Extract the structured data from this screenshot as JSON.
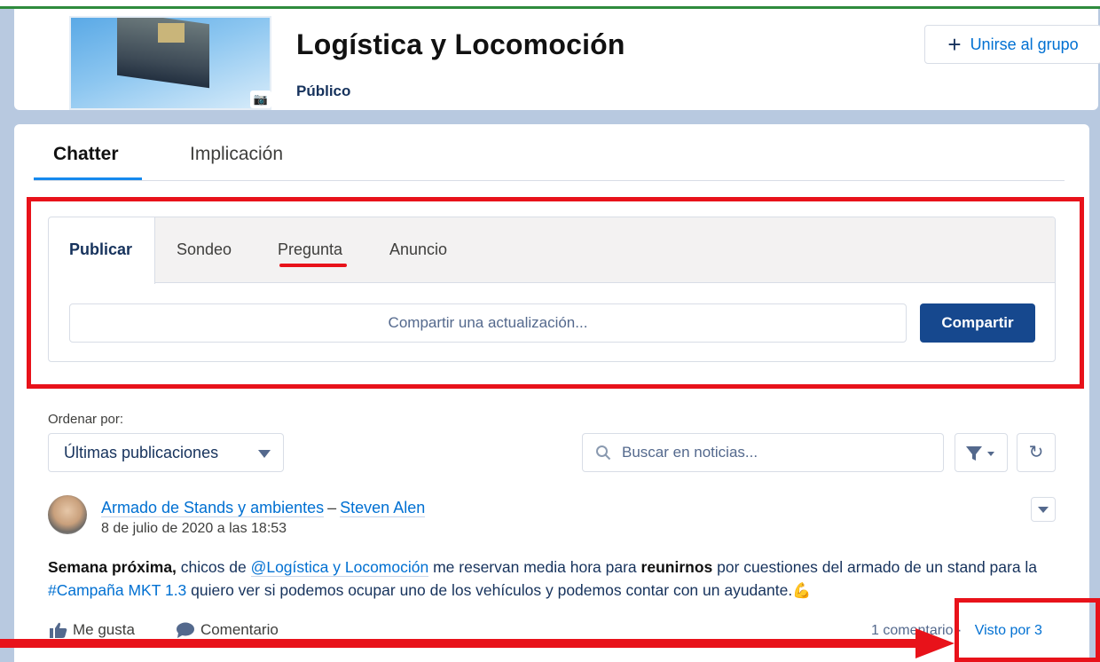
{
  "group": {
    "title": "Logística y Locomoción",
    "visibility": "Público",
    "join_label": "Unirse al grupo"
  },
  "tabs": [
    {
      "label": "Chatter",
      "active": true
    },
    {
      "label": "Implicación",
      "active": false
    }
  ],
  "publisher": {
    "tabs": [
      "Publicar",
      "Sondeo",
      "Pregunta",
      "Anuncio"
    ],
    "input_placeholder": "Compartir una actualización...",
    "share_label": "Compartir"
  },
  "feed": {
    "sort_label": "Ordenar por:",
    "sort_value": "Últimas publicaciones",
    "search_placeholder": "Buscar en noticias..."
  },
  "post": {
    "group_link": "Armado de Stands y ambientes",
    "separator": "–",
    "author": "Steven Alen",
    "date": "8 de julio de 2020 a las 18:53",
    "body_bold_1": "Semana próxima,",
    "body_text_1": " chicos de ",
    "body_mention": "@Logística y Locomoción",
    "body_text_2": " me reservan media hora para ",
    "body_bold_2": "reunirnos",
    "body_text_3": " por cuestiones del armado de un stand para la ",
    "body_hashtag": "#Campaña MKT 1.3",
    "body_text_4": " quiero ver si podemos ocupar uno de los vehículos y podemos contar con un ayudante.",
    "body_emoji": "💪",
    "like_label": "Me gusta",
    "comment_label": "Comentario",
    "comments_count": "1 comentario",
    "stats_separator": "·",
    "seen_by": "Visto por 3"
  },
  "colors": {
    "annotation_red": "#e8121a",
    "primary_button": "#16488e",
    "link_blue": "#0070d2"
  }
}
